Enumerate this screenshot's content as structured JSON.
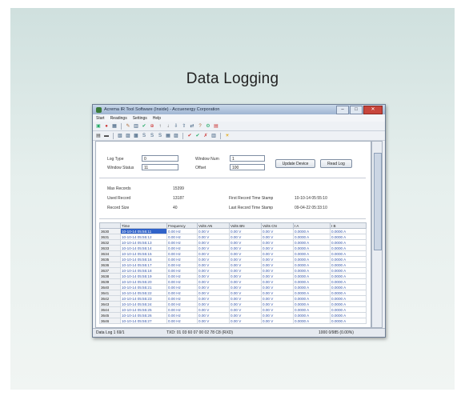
{
  "page_title": "Data Logging",
  "window": {
    "title": "Acrema IR Tool Software (Inside) - Accuenergy Corporation",
    "controls": [
      "–",
      "□",
      "✕"
    ]
  },
  "menu": [
    "Start",
    "Readings",
    "Settings",
    "Help"
  ],
  "toolbar1": [
    "▣",
    "●",
    "▦",
    "✎",
    "▥",
    "✔",
    "⊕",
    "↑",
    "↓",
    "⇩",
    "⇧",
    "⇄",
    "?",
    "⚙",
    "▤"
  ],
  "toolbar2": [
    "▤",
    "▬",
    "▧",
    "▨",
    "▩",
    "S",
    "S",
    "S",
    "▦",
    "▨",
    "✔",
    "✔",
    "✗",
    "▥",
    "☀"
  ],
  "log": {
    "log_type_label": "Log Type",
    "log_type_value": "0",
    "window_num_label": "Window Num",
    "window_num_value": "1",
    "window_status_label": "Window Status",
    "window_status_value": "11",
    "offset_label": "Offset",
    "offset_value": "100",
    "update_button": "Update Device",
    "read_button": "Read Log"
  },
  "records": {
    "max_label": "Max Records",
    "max_value": "15399",
    "used_label": "Used Record",
    "used_value": "13187",
    "size_label": "Record Size",
    "size_value": "40",
    "first_label": "First Record Time Stamp",
    "first_value": "10-10-14 05:55:10",
    "last_label": "Last Record Time Stamp",
    "last_value": "09-04-22 05:33:10"
  },
  "table": {
    "columns": [
      "",
      "Time",
      "Frequency",
      "Volts AN",
      "Volts BN",
      "Volts CN",
      "I A",
      "I B"
    ],
    "rows": [
      [
        "3630",
        "10-10-14 05:55:11",
        "0.00 Hz",
        "0.00 V",
        "0.00 V",
        "0.00 V",
        "0.0000 A",
        "0.0000 A"
      ],
      [
        "3631",
        "10-10-14 05:55:12",
        "0.00 Hz",
        "0.00 V",
        "0.00 V",
        "0.00 V",
        "0.0000 A",
        "0.0000 A"
      ],
      [
        "3632",
        "10-10-14 05:55:13",
        "0.00 Hz",
        "0.00 V",
        "0.00 V",
        "0.00 V",
        "0.0000 A",
        "0.0000 A"
      ],
      [
        "3633",
        "10-10-14 05:55:14",
        "0.00 Hz",
        "0.00 V",
        "0.00 V",
        "0.00 V",
        "0.0000 A",
        "0.0000 A"
      ],
      [
        "3634",
        "10-10-14 05:55:15",
        "0.00 Hz",
        "0.00 V",
        "0.00 V",
        "0.00 V",
        "0.0000 A",
        "0.0000 A"
      ],
      [
        "3635",
        "10-10-14 05:55:16",
        "0.00 Hz",
        "0.00 V",
        "0.00 V",
        "0.00 V",
        "0.0000 A",
        "0.0000 A"
      ],
      [
        "3636",
        "10-10-14 05:55:17",
        "0.00 Hz",
        "0.00 V",
        "0.00 V",
        "0.00 V",
        "0.0000 A",
        "0.0000 A"
      ],
      [
        "3637",
        "10-10-14 05:55:18",
        "0.00 Hz",
        "0.00 V",
        "0.00 V",
        "0.00 V",
        "0.0000 A",
        "0.0000 A"
      ],
      [
        "3638",
        "10-10-14 05:55:19",
        "0.00 Hz",
        "0.00 V",
        "0.00 V",
        "0.00 V",
        "0.0000 A",
        "0.0000 A"
      ],
      [
        "3639",
        "10-10-14 05:55:20",
        "0.00 Hz",
        "0.00 V",
        "0.00 V",
        "0.00 V",
        "0.0000 A",
        "0.0000 A"
      ],
      [
        "3640",
        "10-10-14 05:55:21",
        "0.00 Hz",
        "0.00 V",
        "0.00 V",
        "0.00 V",
        "0.0000 A",
        "0.0000 A"
      ],
      [
        "3641",
        "10-10-14 05:55:22",
        "0.00 Hz",
        "0.00 V",
        "0.00 V",
        "0.00 V",
        "0.0000 A",
        "0.0000 A"
      ],
      [
        "3642",
        "10-10-14 05:55:23",
        "0.00 Hz",
        "0.00 V",
        "0.00 V",
        "0.00 V",
        "0.0000 A",
        "0.0000 A"
      ],
      [
        "3643",
        "10-10-14 05:55:24",
        "0.00 Hz",
        "0.00 V",
        "0.00 V",
        "0.00 V",
        "0.0000 A",
        "0.0000 A"
      ],
      [
        "3644",
        "10-10-14 05:55:25",
        "0.00 Hz",
        "0.00 V",
        "0.00 V",
        "0.00 V",
        "0.0000 A",
        "0.0000 A"
      ],
      [
        "3645",
        "10-10-14 05:55:26",
        "0.00 Hz",
        "0.00 V",
        "0.00 V",
        "0.00 V",
        "0.0000 A",
        "0.0000 A"
      ],
      [
        "3646",
        "10-10-14 05:55:27",
        "0.00 Hz",
        "0.00 V",
        "0.00 V",
        "0.00 V",
        "0.0000 A",
        "0.0000 A"
      ]
    ]
  },
  "status": {
    "left": "Data Log 1  69/1",
    "middle": "TXD: 01 03 60 07 00 02 78 C8 (RXD)",
    "right": "1000   0/985  (0.00%)"
  }
}
